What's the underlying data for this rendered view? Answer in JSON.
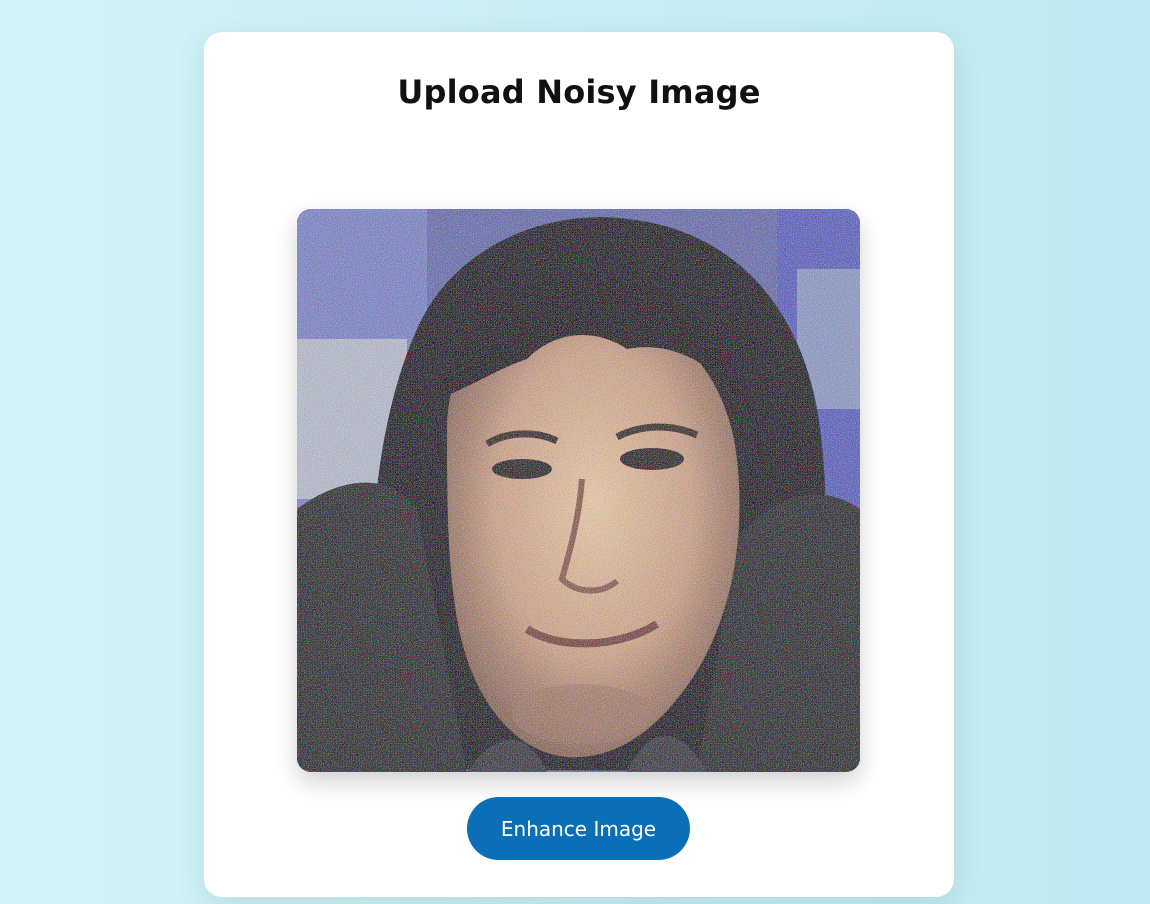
{
  "card": {
    "title": "Upload Noisy Image"
  },
  "preview": {
    "icon": "noisy-portrait-photo"
  },
  "actions": {
    "enhance_label": "Enhance Image"
  },
  "colors": {
    "background": "#c8eef3",
    "card": "#ffffff",
    "button": "#0a6fb6",
    "button_text": "#ffffff"
  }
}
